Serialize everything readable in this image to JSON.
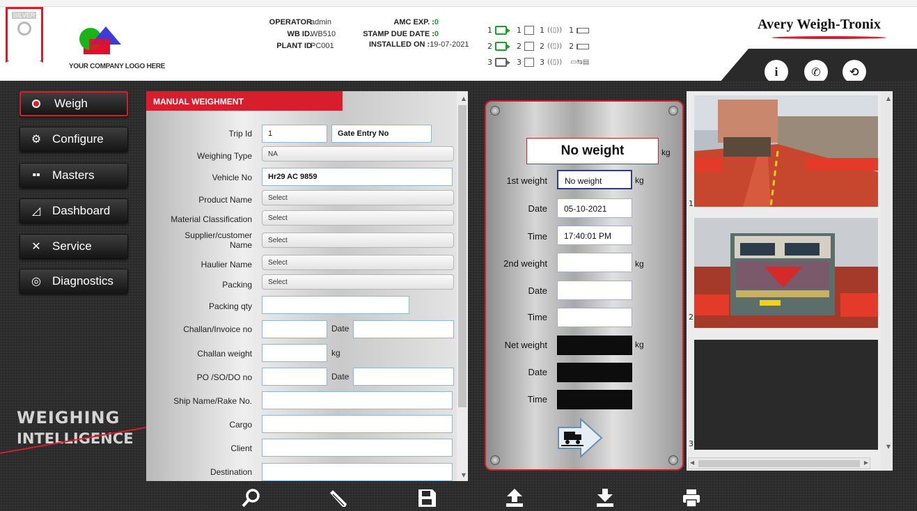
{
  "header": {
    "badge_label": "SILVER",
    "logo_text": "YOUR COMPANY LOGO HERE",
    "operator_label": "OPERATOR",
    "operator_value": "admin",
    "wbid_label": "WB ID.",
    "wbid_value": "WB510",
    "plant_label": "PLANT ID",
    "plant_value": "PC001",
    "amc_label": "AMC EXP. :",
    "amc_value": "0",
    "stamp_label": "STAMP DUE DATE :",
    "stamp_value": "0",
    "installed_label": "INSTALLED ON :",
    "installed_value": "19-07-2021",
    "brand": "Avery Weigh-Tronix",
    "devices": {
      "row1": [
        "1",
        "1",
        "1",
        "1"
      ],
      "row2": [
        "2",
        "2",
        "2",
        "2"
      ],
      "row3": [
        "3",
        "3",
        "3"
      ]
    },
    "buttons": [
      "info-icon",
      "phone-icon",
      "logout-icon"
    ]
  },
  "sidebar": {
    "items": [
      {
        "label": "Weigh",
        "icon": "gauge-icon",
        "active": true
      },
      {
        "label": "Configure",
        "icon": "gear-icon"
      },
      {
        "label": "Masters",
        "icon": "grid-icon"
      },
      {
        "label": "Dashboard",
        "icon": "wifi-icon"
      },
      {
        "label": "Service",
        "icon": "tools-icon"
      },
      {
        "label": "Diagnostics",
        "icon": "diagnostics-icon"
      }
    ],
    "tagline_1": "WEIGHING",
    "tagline_2": "INTELLIGENCE"
  },
  "form": {
    "title": "MANUAL WEIGHMENT",
    "trip_id_label": "Trip Id",
    "trip_id_value": "1",
    "gate_entry_placeholder": "Gate Entry No",
    "weighing_type_label": "Weighing Type",
    "weighing_type_value": "NA",
    "vehicle_no_label": "Vehicle No",
    "vehicle_no_value": "Hr29 AC 9859",
    "product_name_label": "Product Name",
    "product_name_value": "Select",
    "material_label": "Material Classification",
    "material_value": "Select",
    "supplier_label_1": "Supplier/customer",
    "supplier_label_2": "Name",
    "supplier_value": "Select",
    "haulier_label": "Haulier Name",
    "haulier_value": "Select",
    "packing_label": "Packing",
    "packing_value": "Select",
    "packing_qty_label": "Packing qty",
    "challan_label": "Challan/Invoice no",
    "date_label": "Date",
    "challan_weight_label": "Challan weight",
    "kg": "kg",
    "po_label": "PO /SO/DO no",
    "ship_label": "Ship Name/Rake No.",
    "cargo_label": "Cargo",
    "client_label": "Client",
    "destination_label": "Destination"
  },
  "weight": {
    "display": "No weight",
    "kg": "kg",
    "first_weight_label": "1st weight",
    "first_weight_value": "No weight",
    "date_label": "Date",
    "date_value": "05-10-2021",
    "time_label": "Time",
    "time_value": "17:40:01 PM",
    "second_weight_label": "2nd weight",
    "net_weight_label": "Net weight"
  },
  "cameras": {
    "labels": [
      "1",
      "2",
      "3"
    ]
  },
  "toolbar": {
    "buttons": [
      "search-icon",
      "edit-icon",
      "save-icon",
      "upload-icon",
      "download-icon",
      "print-icon"
    ]
  },
  "colors": {
    "accent_red": "#d81e2c",
    "status_green": "#1a9e2c",
    "panel_dark": "#2b2b2b"
  }
}
